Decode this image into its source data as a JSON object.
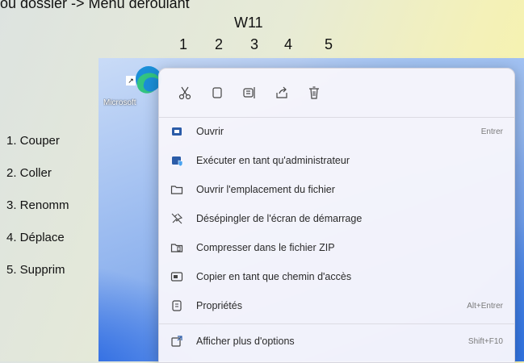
{
  "slide": {
    "title": "ou dossier -> Menu déroulant",
    "subtitle": "W11",
    "numbers": [
      "1",
      "2",
      "3",
      "4",
      "5"
    ],
    "legend": [
      "1. Couper",
      "2. Coller",
      "3. Renomm",
      "4. Déplace",
      "5. Supprim"
    ]
  },
  "desktop": {
    "icon_label": "Microsoft"
  },
  "context_menu": {
    "toolbar": [
      {
        "name": "cut-icon",
        "tooltip": "Couper"
      },
      {
        "name": "copy-icon",
        "tooltip": "Coller"
      },
      {
        "name": "rename-icon",
        "tooltip": "Renommer"
      },
      {
        "name": "share-icon",
        "tooltip": "Déplacer"
      },
      {
        "name": "delete-icon",
        "tooltip": "Supprimer"
      }
    ],
    "items": [
      {
        "label": "Ouvrir",
        "shortcut": "Entrer"
      },
      {
        "label": "Exécuter en tant qu'administrateur",
        "shortcut": ""
      },
      {
        "label": "Ouvrir l'emplacement du fichier",
        "shortcut": ""
      },
      {
        "label": "Désépingler de l'écran de démarrage",
        "shortcut": ""
      },
      {
        "label": "Compresser dans le fichier ZIP",
        "shortcut": ""
      },
      {
        "label": "Copier en tant que chemin d'accès",
        "shortcut": ""
      },
      {
        "label": "Propriétés",
        "shortcut": "Alt+Entrer"
      },
      {
        "label": "Afficher plus d'options",
        "shortcut": "Shift+F10"
      }
    ]
  },
  "colors": {
    "accent": "#1a66e0",
    "menu_bg": "#f6f5fb",
    "icon_blue": "#2b5ca8"
  }
}
